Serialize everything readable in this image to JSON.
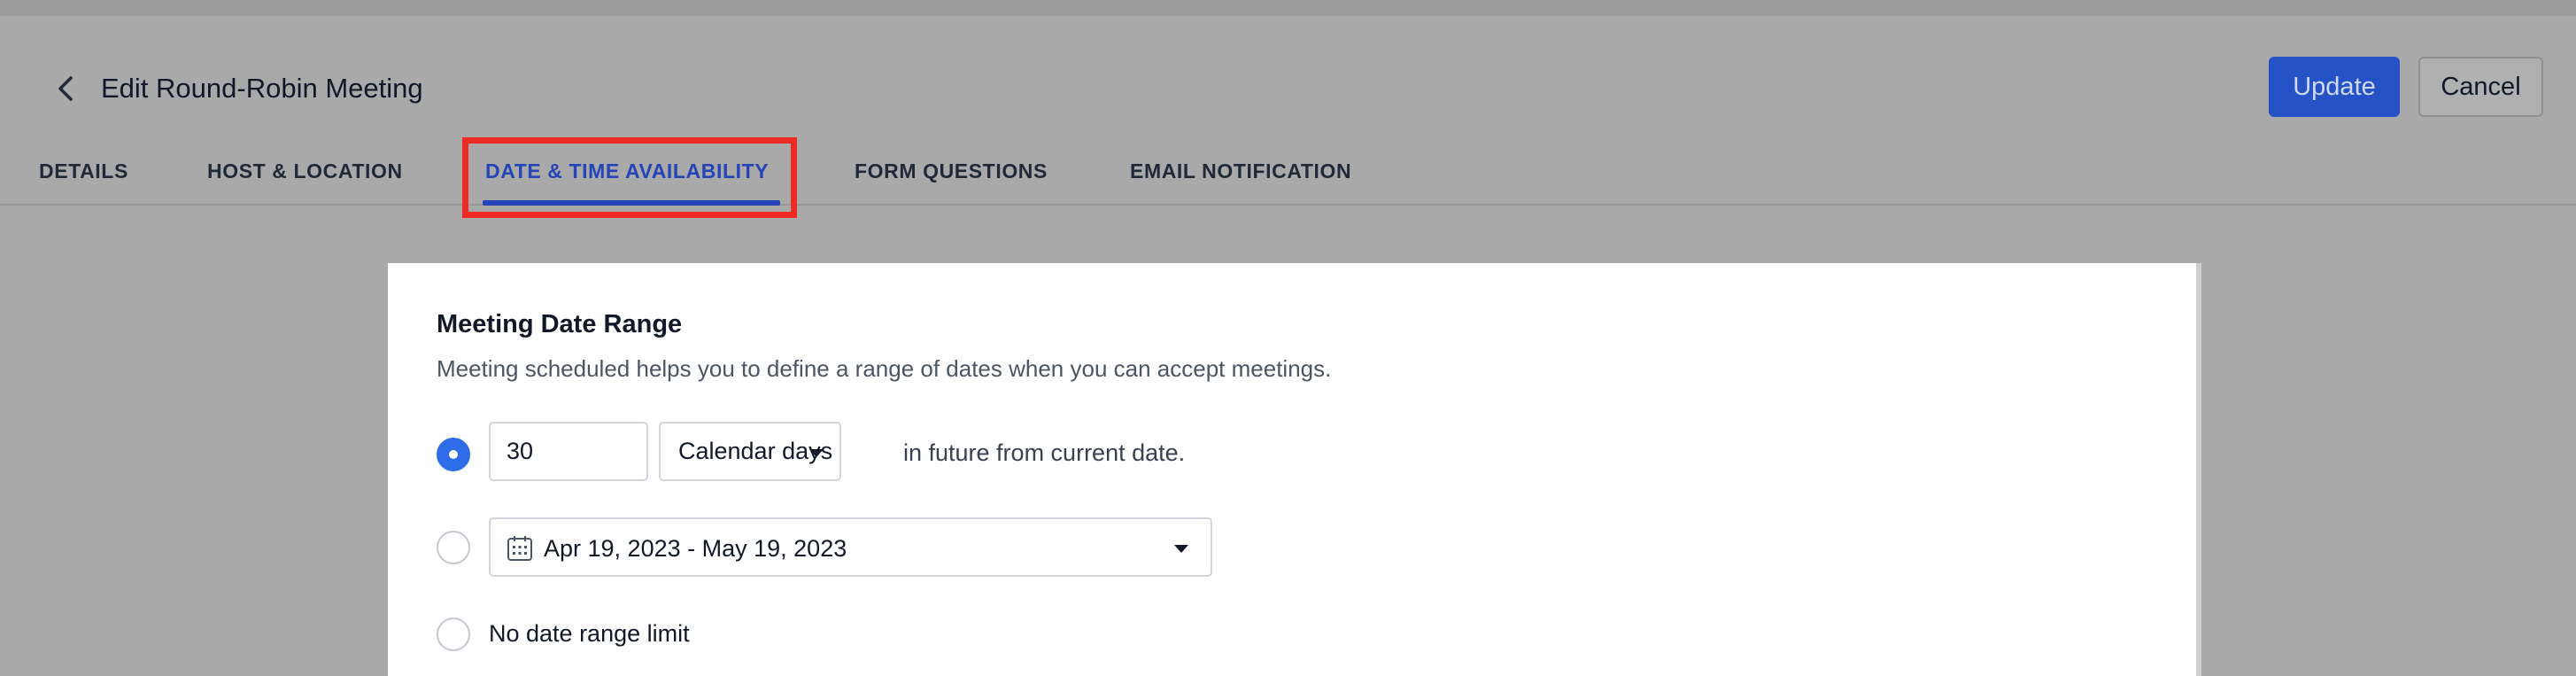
{
  "header": {
    "title": "Edit Round-Robin Meeting",
    "update_label": "Update",
    "cancel_label": "Cancel"
  },
  "tabs": [
    {
      "label": "DETAILS",
      "active": false
    },
    {
      "label": "HOST & LOCATION",
      "active": false
    },
    {
      "label": "DATE & TIME AVAILABILITY",
      "active": true
    },
    {
      "label": "FORM QUESTIONS",
      "active": false
    },
    {
      "label": "EMAIL NOTIFICATION",
      "active": false
    }
  ],
  "date_range": {
    "title": "Meeting Date Range",
    "description": "Meeting scheduled helps you to define a range of dates when you can accept meetings.",
    "options": {
      "rolling": {
        "selected": true,
        "days_value": "30",
        "unit": "Calendar days",
        "suffix": "in future from current date."
      },
      "fixed": {
        "selected": false,
        "range": "Apr 19, 2023 - May 19, 2023"
      },
      "unlimited": {
        "selected": false,
        "label": "No date range limit"
      }
    }
  },
  "colors": {
    "primary": "#2553c6",
    "active_tab": "#2444b8",
    "highlight": "#ee2a24",
    "radio_checked": "#2f6de8"
  },
  "icons": [
    "chevron-left-icon",
    "calendar-icon",
    "caret-down-icon"
  ]
}
